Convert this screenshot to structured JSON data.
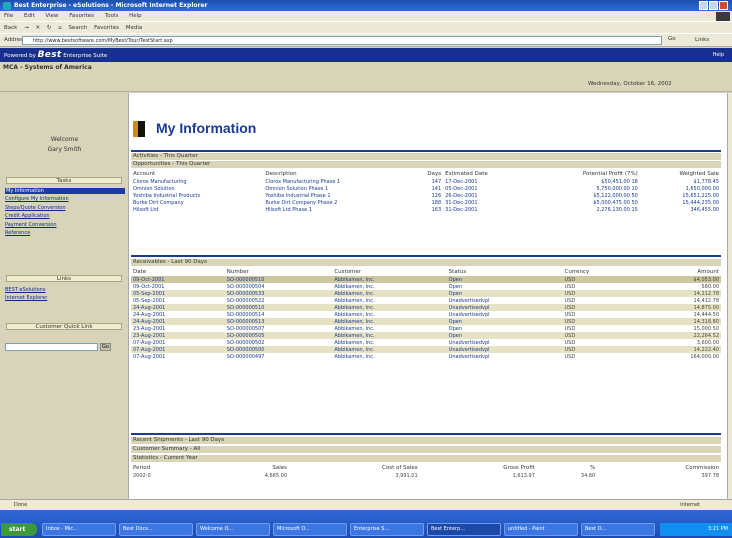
{
  "window": {
    "title": "Best Enterprise - eSolutions - Microsoft Internet Explorer"
  },
  "menu": [
    "File",
    "Edit",
    "View",
    "Favorites",
    "Tools",
    "Help"
  ],
  "toolbar": {
    "back": "Back",
    "search": "Search",
    "favorites": "Favorites",
    "media": "Media"
  },
  "address": {
    "label": "Address",
    "url": "http://www.bestsoftware.com/MyBest/Tour/TestStart.asp",
    "go": "Go",
    "links": "Links"
  },
  "brand": {
    "prefix": "Powered by",
    "name": "Best",
    "suffix": "Enterprise Suite",
    "help": "Help"
  },
  "org": {
    "name": "MCA - Systems of America",
    "date": "Wednesday, October 16, 2002"
  },
  "sidebar": {
    "welcome": "Welcome",
    "user": "Gary Smith",
    "tasks_head": "Tasks",
    "tasks": [
      "My Information",
      "Configure My Information",
      "Steps/Quote Conversion",
      "Credit Application",
      "Payment Conversion",
      "Reference"
    ],
    "links_head": "Links",
    "links": [
      "BEST eSolutions",
      "Internet Explorer"
    ],
    "quicklink_head": "Customer Quick Link",
    "go": "Go"
  },
  "main": {
    "title": "My Information",
    "activities": "Activities - This Quarter",
    "opportunities": "Opportunities - This Quarter",
    "opp_cols": [
      "Account",
      "Description",
      "Days",
      "Estimated Date",
      "Potential Profit (7%)",
      "Weighted Sale"
    ],
    "opp_rows": [
      [
        "Clorox Manufacturing",
        "Clorox Manufacturing Phase 1",
        "147",
        "17-Dec-2001",
        "$50,451.00 18",
        "$1,778.45"
      ],
      [
        "Omnion Solution",
        "Omnion Solution Phase 1",
        "141",
        "05-Dec-2001",
        "5,750,000.00 10",
        "1,650,000.00"
      ],
      [
        "Yoshiba Industrial Products",
        "Yoshiba Industrial Phase 1",
        "126",
        "26-Dec-2001",
        "$5,122,000.00 50",
        "15,651,225.00"
      ],
      [
        "Burke Dirt Company",
        "Burke Dirt Company Phase 2",
        "188",
        "31-Dec-2001",
        "$5,000,475.00 50",
        "15,444,235.00"
      ],
      [
        "Hilsoft Ltd",
        "Hilsoft Ltd Phase 1",
        "163",
        "31-Dec-2001",
        "2,276,130.00 15",
        "346,455.00"
      ]
    ],
    "receivables": "Receivables - Last 90 Days",
    "rec_cols": [
      "Date",
      "Number",
      "Customer",
      "Status",
      "Currency",
      "Amount"
    ],
    "rec_rows": [
      [
        "09-Oct-2001",
        "SO-000000510",
        "Abbikamen, Inc.",
        "Open",
        "USD",
        "$4,053.00"
      ],
      [
        "09-Oct-2001",
        "SO-000000504",
        "Abbikamen, Inc.",
        "Open",
        "USD",
        "580.00"
      ],
      [
        "05-Sep-2001",
        "SO-000000533",
        "Abbikamen, Inc.",
        "Open",
        "USD",
        "14,212.78"
      ],
      [
        "05-Sep-2001",
        "SO-000000522",
        "Abbikamen, Inc.",
        "Unadvertisedvpl",
        "USD",
        "14,412.78"
      ],
      [
        "24-Aug-2001",
        "SO-000000510",
        "Abbikamen, Inc.",
        "Unadvertisedvpl",
        "USD",
        "14,875.00"
      ],
      [
        "24-Aug-2001",
        "SO-000000514",
        "Abbikamen, Inc.",
        "Unadvertisedvpl",
        "USD",
        "14,444.50"
      ],
      [
        "24-Aug-2001",
        "SO-000000513",
        "Abbikamen, Inc.",
        "Open",
        "USD",
        "14,318.80"
      ],
      [
        "23-Aug-2001",
        "SO-000000507",
        "Abbikamen, Inc.",
        "Open",
        "USD",
        "15,000.50"
      ],
      [
        "23-Aug-2001",
        "SO-000000505",
        "Abbikamen, Inc.",
        "Open",
        "USD",
        "22,264.52"
      ],
      [
        "07-Aug-2001",
        "SO-000000502",
        "Abbikamen, Inc.",
        "Unadvertisedvpl",
        "USD",
        "3,600.00"
      ],
      [
        "07-Aug-2001",
        "SO-000000500",
        "Abbikamen, Inc.",
        "Unadvertisedvpl",
        "USD",
        "14,222.40"
      ],
      [
        "07-Aug-2001",
        "SO-000000497",
        "Abbikamen, Inc.",
        "Unadvertisedvpl",
        "USD",
        "164,000.00"
      ]
    ],
    "shipments": "Recent Shipments - Last 90 Days",
    "customer_summary": "Customer Summary - All",
    "statistics": "Statistics - Current Year",
    "stat_cols": [
      "Period",
      "Sales",
      "Cost of Sales",
      "Gross Profit",
      "%",
      "Commission"
    ],
    "stat_rows": [
      [
        "2002-0",
        "4,665.00",
        "3,991.01",
        "1,613.97",
        "34.60",
        "397.78"
      ]
    ]
  },
  "status": {
    "left": "Done",
    "zone": "Internet"
  },
  "taskbar": {
    "start": "start",
    "tasks": [
      "Inbox - Mic...",
      "Best Docs...",
      "Welcome O...",
      "Microsoft O...",
      "Enterprise S...",
      "Best Enterp...",
      "untitled - Paint",
      "Best O..."
    ],
    "clock": "3:21 PM"
  }
}
